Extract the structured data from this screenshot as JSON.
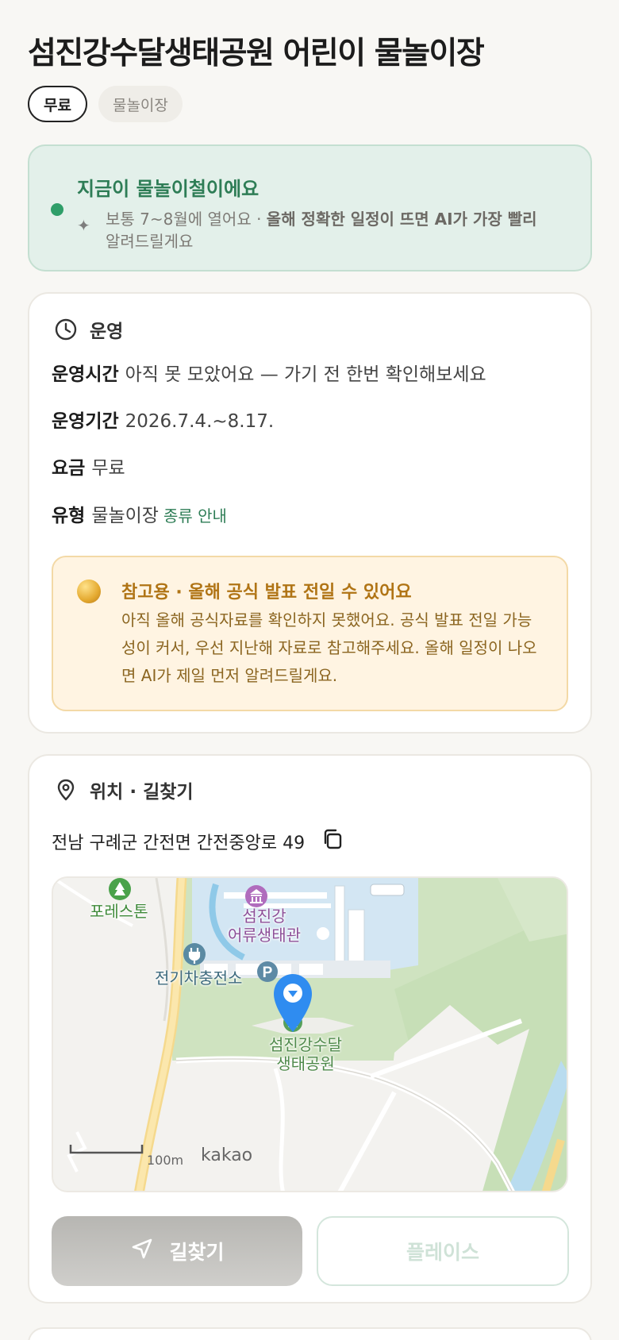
{
  "header": {
    "title": "섬진강수달생태공원 어린이 물놀이장",
    "tags": [
      "무료",
      "물놀이장"
    ]
  },
  "season_banner": {
    "title": "지금이 물놀이철이에요",
    "text_plain": "보통 7~8월에 열어요 · ",
    "text_bold": "올해 정확한 일정이 뜨면 AI가 가장 빨리",
    "text_tail": "알려드릴게요",
    "accent_color": "#2f9e69",
    "icons": [
      "status-dot",
      "sparkle-icon"
    ]
  },
  "operation": {
    "section_title": "운영",
    "icon": "clock-icon",
    "rows": [
      {
        "key": "운영시간",
        "value": "아직 못 모았어요 — 가기 전 한번 확인해보세요"
      },
      {
        "key": "운영기간",
        "value": "2026.7.4.~8.17."
      },
      {
        "key": "요금",
        "value": "무료"
      },
      {
        "key": "유형",
        "value": "물놀이장",
        "link": "종류 안내"
      }
    ],
    "notice": {
      "title": "참고용 · 올해 공식 발표 전일 수 있어요",
      "body": "아직 올해 공식자료를 확인하지 못했어요. 공식 발표 전일 가능성이 커서, 우선 지난해 자료로 참고해주세요. 올해 일정이 나오면 AI가 제일 먼저 알려드릴게요.",
      "color": "#b07415"
    }
  },
  "location": {
    "section_title": "위치 · 길찾기",
    "icon": "location-pin-icon",
    "address": "전남 구례군 간전면 간전중앙로 49",
    "copy_icon": "copy-icon",
    "map": {
      "labels": {
        "forest": "포레스톤",
        "museum_line1": "섬진강",
        "museum_line2": "어류생태관",
        "ev_station": "전기차충전소",
        "park_line1": "섬진강수달",
        "park_line2": "생태공원",
        "parking": "P"
      },
      "scale": "100m",
      "brand": "kakao",
      "marker_color": "#2f8cf0"
    },
    "buttons": {
      "directions": "길찾기",
      "place": "플레이스"
    }
  }
}
